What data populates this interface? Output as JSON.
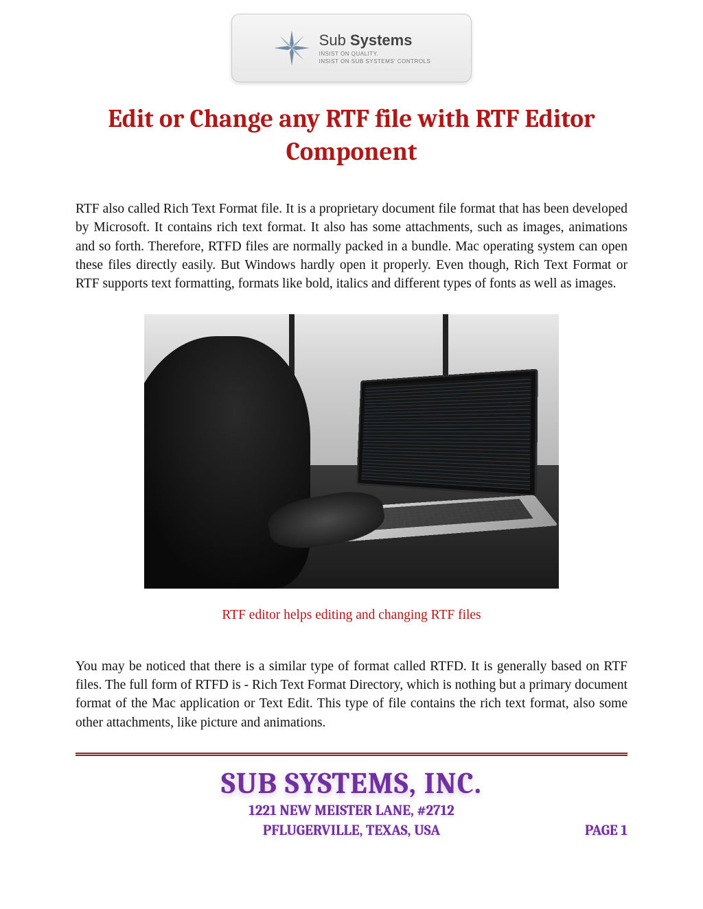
{
  "logo": {
    "brand_prefix": "Sub ",
    "brand_bold": "Systems",
    "tagline1": "INSIST ON QUALITY.",
    "tagline2": "INSIST ON SUB SYSTEMS' CONTROLS"
  },
  "title": "Edit or Change any RTF file with RTF Editor Component",
  "para1": "RTF also called Rich Text Format file. It is a proprietary document file format that has been developed by Microsoft. It contains rich text format. It also has some attachments, such as images, animations and so forth. Therefore, RTFD files are normally packed in a bundle. Mac operating system can open these files directly easily. But Windows hardly open it properly. Even though, Rich Text Format or RTF supports text formatting, formats like bold, italics and different types of fonts as well as images.",
  "caption": "RTF editor helps editing and changing RTF files",
  "para2": "You may be noticed that there is a similar type of format called RTFD. It is generally based on RTF files. The full form of RTFD is - Rich Text Format Directory, which is nothing but a primary document format of the Mac application or Text Edit. This type of file contains the rich text format, also some other attachments, like picture and animations.",
  "footer": {
    "company": "SUB SYSTEMS, INC.",
    "address1": "1221 NEW MEISTER LANE, #2712",
    "address2": "PFLUGERVILLE, TEXAS, USA",
    "page": "PAGE 1"
  }
}
